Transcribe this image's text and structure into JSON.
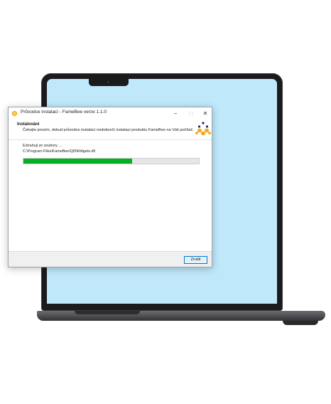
{
  "window": {
    "title": "Průvodce instalací - FameBee verze 1.1.0",
    "controls": {
      "minimize": "–",
      "maximize": "□",
      "close": "✕"
    },
    "icon": "famebee-logo-icon"
  },
  "header": {
    "title": "Instalování",
    "subtitle": "Čekejte prosím, dokud průvodce instalací nedokončí instalaci produktu FameBee na Váš počítač."
  },
  "body": {
    "status": "Extrahuji ze soubory ...",
    "current_file": "C:\\Program Files\\FameBee\\Qt5Widgets.dll",
    "progress": 0.62
  },
  "footer": {
    "cancel_label": "Zrušit"
  },
  "colors": {
    "progress_fill": "#06b025",
    "screen": "#bfe8fb",
    "logo_gold": "#f4a921",
    "logo_navy": "#1f2a5c",
    "button_border": "#0078d7"
  }
}
